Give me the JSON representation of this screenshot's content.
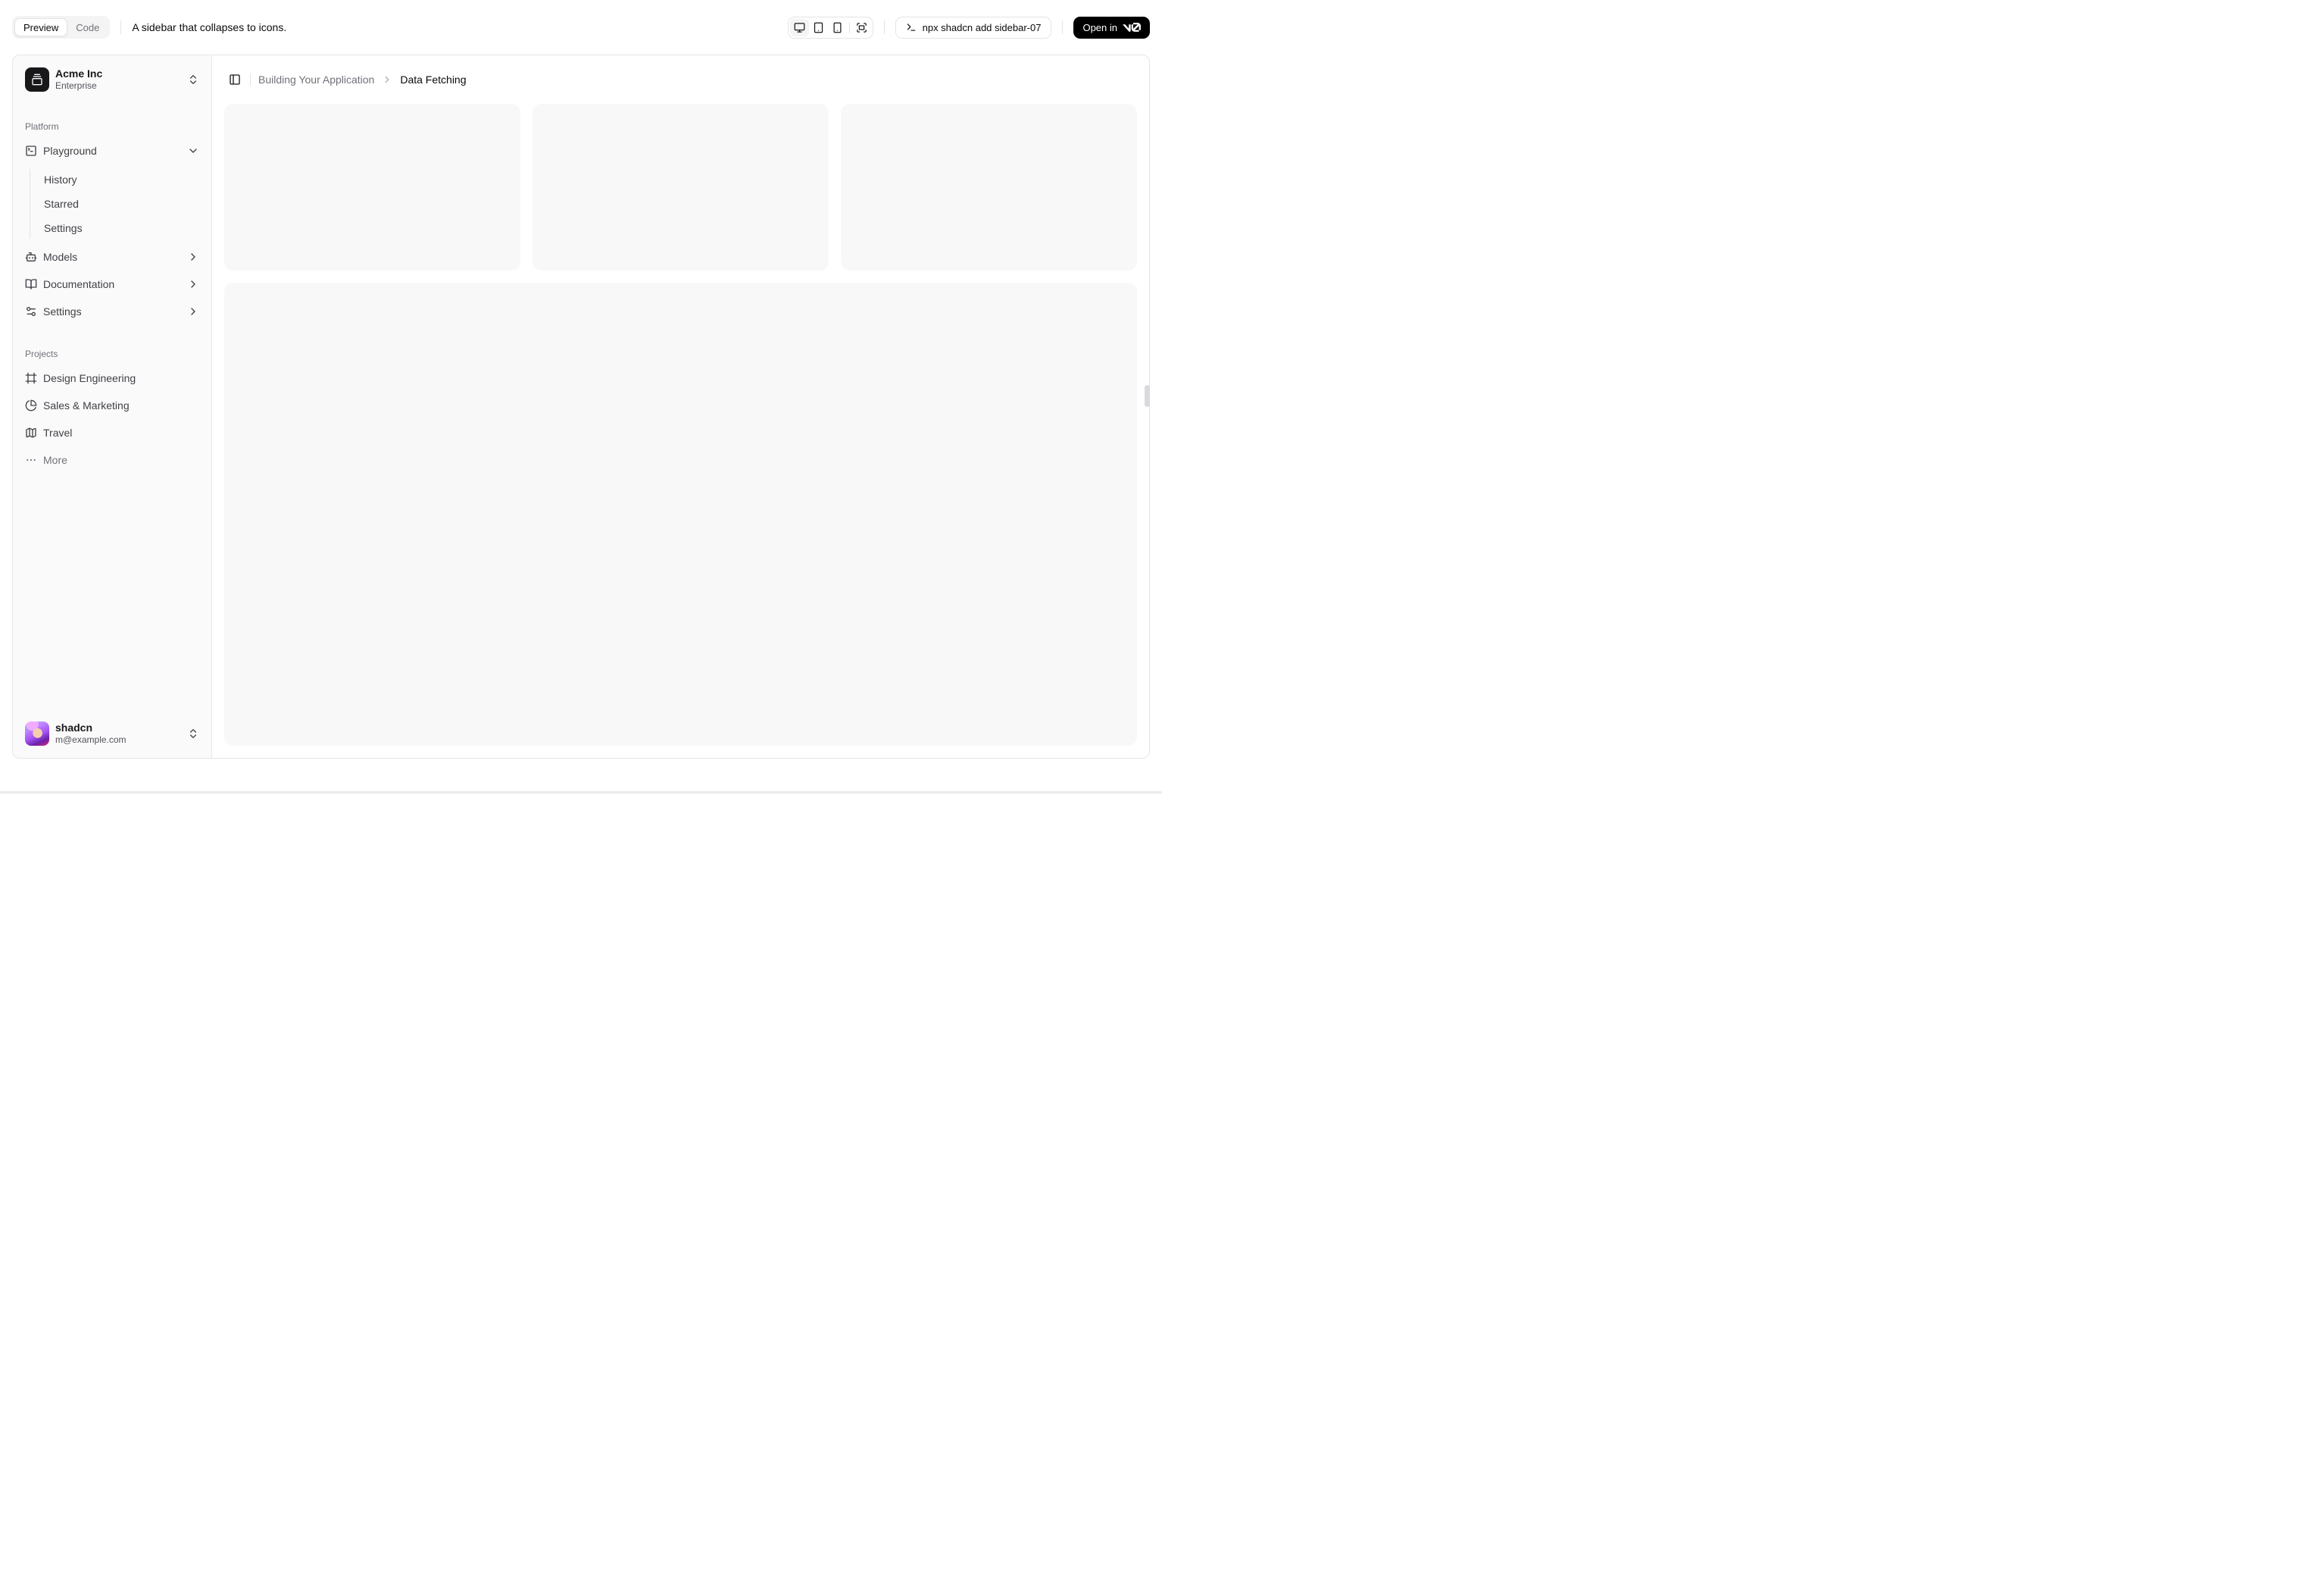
{
  "toolbar": {
    "tabs": [
      {
        "label": "Preview",
        "active": true
      },
      {
        "label": "Code",
        "active": false
      }
    ],
    "description": "A sidebar that collapses to icons.",
    "device_toggles": [
      "monitor-icon",
      "tablet-icon",
      "smartphone-icon",
      "fullscreen-icon"
    ],
    "command": "npx shadcn add sidebar-07",
    "command_icon": "terminal-icon",
    "open_in_label": "Open in",
    "open_in_logo": "v0-logo"
  },
  "sidebar": {
    "team": {
      "name": "Acme Inc",
      "plan": "Enterprise",
      "logo_icon": "gallery-vertical-end-icon"
    },
    "groups": [
      {
        "label": "Platform",
        "items": [
          {
            "label": "Playground",
            "icon": "square-terminal-icon",
            "chevron": "chevron-down-icon",
            "children": [
              "History",
              "Starred",
              "Settings"
            ]
          },
          {
            "label": "Models",
            "icon": "bot-icon",
            "chevron": "chevron-right-icon"
          },
          {
            "label": "Documentation",
            "icon": "book-open-icon",
            "chevron": "chevron-right-icon"
          },
          {
            "label": "Settings",
            "icon": "settings-2-icon",
            "chevron": "chevron-right-icon"
          }
        ]
      },
      {
        "label": "Projects",
        "items": [
          {
            "label": "Design Engineering",
            "icon": "frame-icon"
          },
          {
            "label": "Sales & Marketing",
            "icon": "pie-chart-icon"
          },
          {
            "label": "Travel",
            "icon": "map-icon"
          },
          {
            "label": "More",
            "icon": "ellipsis-icon"
          }
        ]
      }
    ],
    "user": {
      "name": "shadcn",
      "email": "m@example.com",
      "avatar_icon": "avatar-image"
    }
  },
  "main": {
    "toggle_icon": "panel-left-icon",
    "breadcrumb": {
      "parent": "Building Your Application",
      "current": "Data Fetching"
    }
  },
  "colors": {
    "open_in_v0_bg": "#000000",
    "sidebar_bg": "#fafafa",
    "placeholder": "#f8f8f9",
    "border": "#e4e4e7"
  }
}
